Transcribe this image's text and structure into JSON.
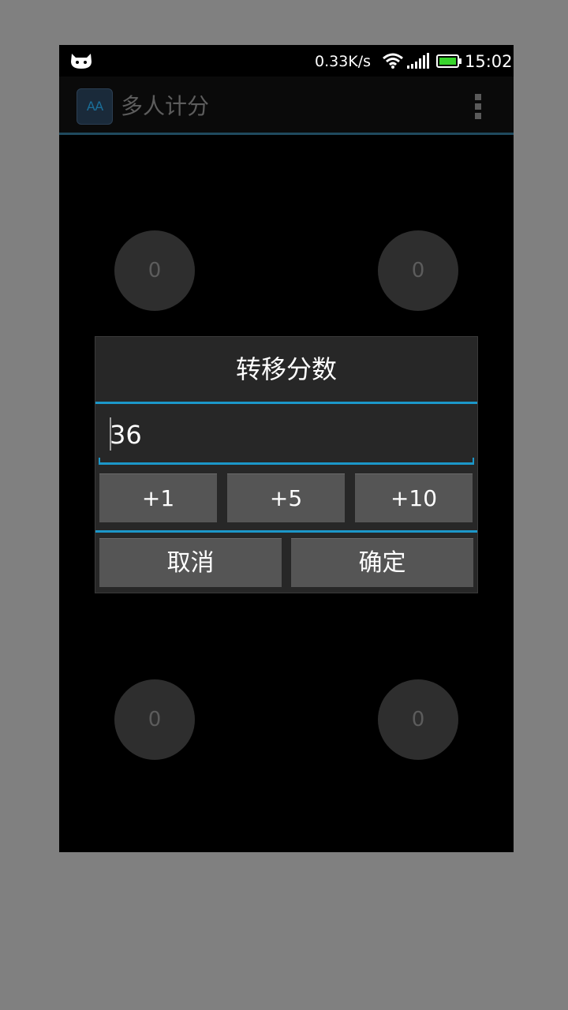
{
  "status_bar": {
    "net_speed": "0.33K/s",
    "time": "15:02",
    "icons": [
      "android-cat-icon",
      "wifi-icon",
      "signal-icon",
      "battery-icon"
    ],
    "battery_color": "#38d42c"
  },
  "action_bar": {
    "app_icon_text": "AA",
    "title": "多人计分",
    "overflow_icon": "overflow-menu-icon"
  },
  "players": [
    {
      "score": "0"
    },
    {
      "score": "0"
    },
    {
      "score": "0"
    },
    {
      "score": "0"
    }
  ],
  "dialog": {
    "title": "转移分数",
    "input_value": "36",
    "increments": [
      "+1",
      "+5",
      "+10"
    ],
    "cancel_label": "取消",
    "confirm_label": "确定",
    "accent_color": "#1c97c9"
  }
}
